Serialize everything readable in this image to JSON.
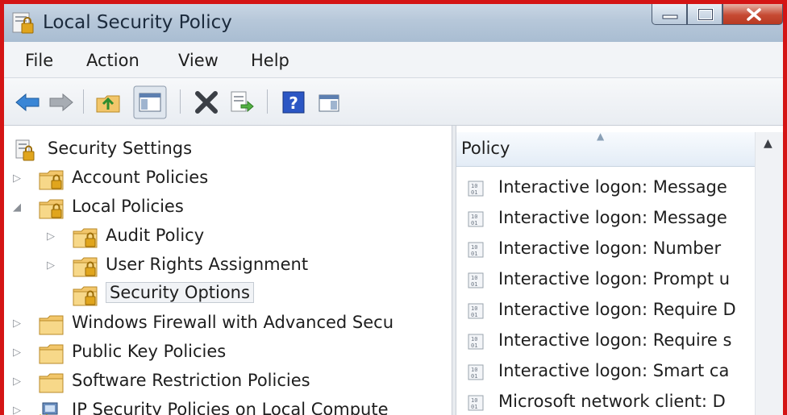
{
  "window": {
    "title": "Local Security Policy"
  },
  "menu": [
    "File",
    "Action",
    "View",
    "Help"
  ],
  "toolbar": {
    "icons": [
      "back-arrow-icon",
      "forward-arrow-icon",
      "up-folder-icon",
      "show-hide-tree-icon",
      "delete-icon",
      "export-list-icon",
      "help-icon",
      "show-hide-action-pane-icon"
    ]
  },
  "tree": {
    "root": "Security Settings",
    "items": [
      {
        "label": "Account Policies",
        "expander": "▷"
      },
      {
        "label": "Local Policies",
        "expander": "◢"
      },
      {
        "label": "Audit Policy",
        "expander": "▷"
      },
      {
        "label": "User Rights Assignment",
        "expander": "▷"
      },
      {
        "label": "Security Options",
        "expander": ""
      },
      {
        "label": "Windows Firewall with Advanced Secu",
        "expander": "▷"
      },
      {
        "label": "Public Key Policies",
        "expander": "▷"
      },
      {
        "label": "Software Restriction Policies",
        "expander": "▷"
      },
      {
        "label": "IP Security Policies on Local Compute",
        "expander": "▷"
      }
    ]
  },
  "list": {
    "column": "Policy",
    "rows": [
      "Interactive logon: Message",
      "Interactive logon: Message",
      "Interactive logon: Number",
      "Interactive logon: Prompt u",
      "Interactive logon: Require D",
      "Interactive logon: Require s",
      "Interactive logon: Smart ca",
      "Microsoft network client: D"
    ]
  },
  "colors": {
    "frame_border": "#d41414",
    "titlebar": "#b6c7d9",
    "folder": "#f2c66a",
    "accent_blue": "#2f6fb5"
  }
}
